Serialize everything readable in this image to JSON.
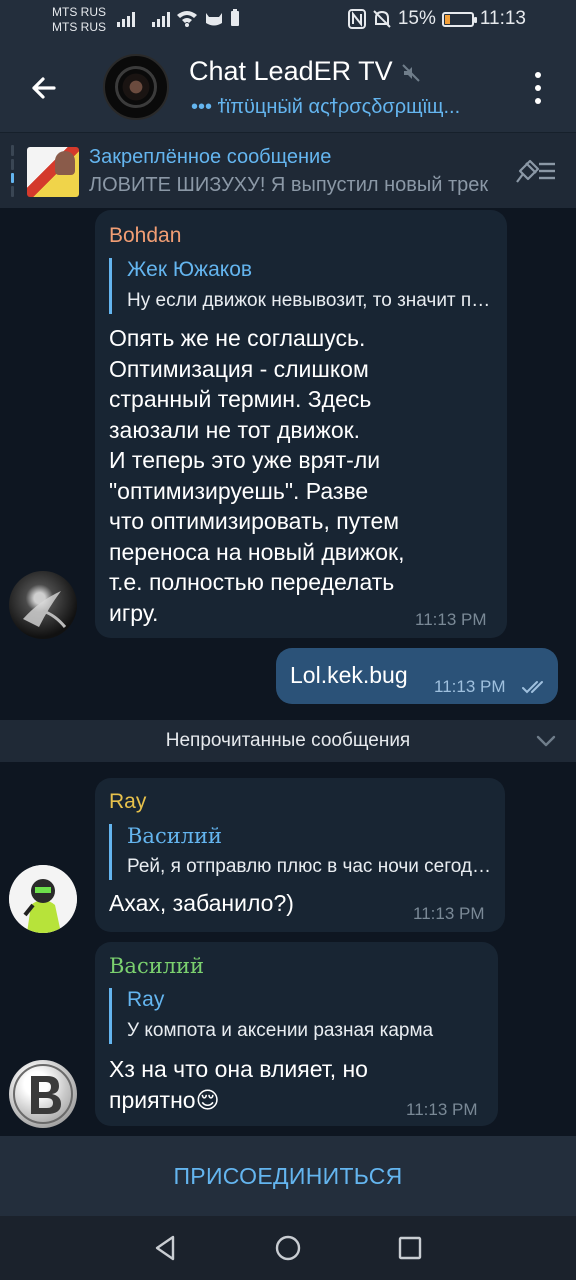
{
  "status_bar": {
    "carrier_1": "MTS RUS",
    "carrier_2": "MTS RUS",
    "battery": "15%",
    "time": "11:13",
    "icons": [
      "signal-icon",
      "signal-icon",
      "wifi-icon",
      "cat-icon",
      "battery-saver-icon",
      "nfc-icon",
      "mute-bell-icon",
      "battery-icon"
    ]
  },
  "header": {
    "title": "Chat LeadER TV",
    "typing": "••• ϯϊπϋцнӹй αςϯρσςδσρщϊщ...",
    "muted_icon": "speaker-mute-icon",
    "menu_icon": "more-vertical-icon",
    "back_icon": "arrow-left-icon"
  },
  "pinned": {
    "title": "Закреплённое сообщение",
    "text": "ЛОВИТЕ ШИЗУХУ! Я выпустил новый трек",
    "list_icon": "pinned-list-icon"
  },
  "messages": [
    {
      "sender": "Bohdan",
      "sender_color": "#f29e74",
      "reply_name": "Жек Южаков",
      "reply_text": "Ну если движок невывозит, то значит плохая оптимизация",
      "lines": [
        "Опять же не соглашусь.",
        "Оптимизация - слишком",
        "странный термин. Здесь",
        "заюзали не тот движок.",
        "И теперь это уже врят-ли",
        "\"оптимизируешь\". Разве",
        "что оптимизировать, путем",
        "переноса на новый движок,",
        "т.е. полностью переделать",
        "игру."
      ],
      "time": "11:13 PM"
    },
    {
      "text": "Lol.kek.bug",
      "time": "11:13 PM",
      "status_icon": "double-check-icon"
    },
    {
      "sender": "Ray",
      "sender_color": "#e8c24c",
      "reply_name": "Василий",
      "reply_text": "Рей, я отправлю плюс в час ночи сегодня",
      "text": "Ахах, забанило?)",
      "time": "11:13 PM"
    },
    {
      "sender": "Василий",
      "sender_color": "#7bd16f",
      "reply_name": "Ray",
      "reply_text": "У компота и аксении разная карма",
      "text_1": "Хз на что она влияет, но",
      "text_2": "приятно",
      "emoji": "😌",
      "time": "11:13 PM"
    }
  ],
  "unread_divider": {
    "label": "Непрочитанные сообщения",
    "icon": "chevron-down-icon"
  },
  "join_button": "ПРИСОЕДИНИТЬСЯ",
  "nav": [
    "back-triangle-icon",
    "home-circle-icon",
    "recents-square-icon"
  ]
}
